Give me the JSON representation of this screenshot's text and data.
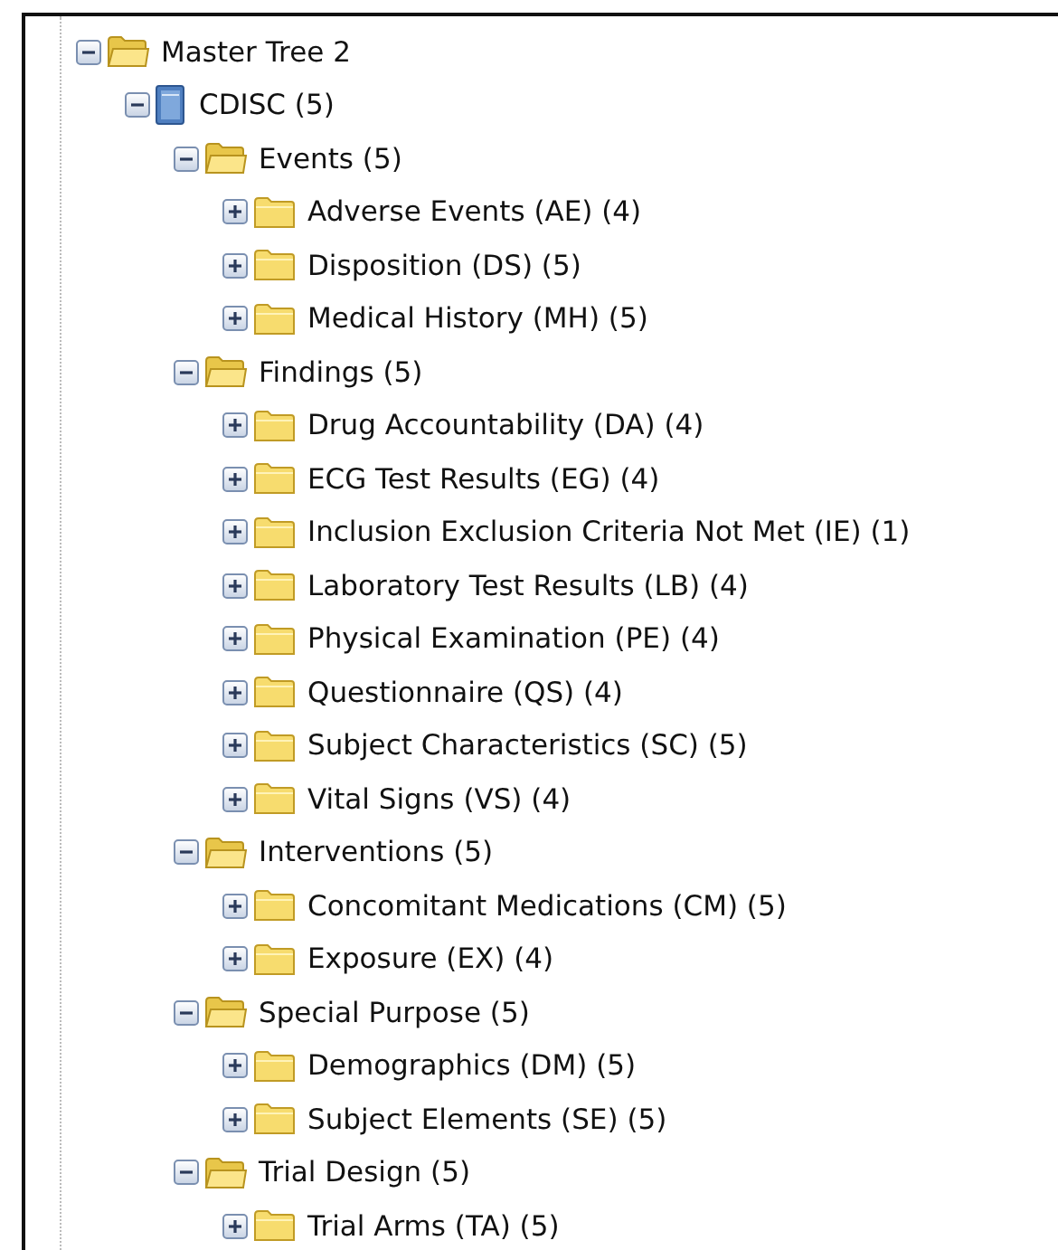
{
  "tree": [
    {
      "label": "Master Tree 2",
      "kind": "folder",
      "expanded": true,
      "children": [
        {
          "label": "CDISC (5)",
          "kind": "book",
          "expanded": true,
          "children": [
            {
              "label": "Events (5)",
              "kind": "folder",
              "expanded": true,
              "children": [
                {
                  "label": "Adverse Events (AE) (4)",
                  "kind": "folder",
                  "expanded": false
                },
                {
                  "label": "Disposition (DS) (5)",
                  "kind": "folder",
                  "expanded": false
                },
                {
                  "label": "Medical History (MH) (5)",
                  "kind": "folder",
                  "expanded": false
                }
              ]
            },
            {
              "label": "Findings (5)",
              "kind": "folder",
              "expanded": true,
              "children": [
                {
                  "label": "Drug Accountability (DA) (4)",
                  "kind": "folder",
                  "expanded": false
                },
                {
                  "label": "ECG Test Results (EG) (4)",
                  "kind": "folder",
                  "expanded": false
                },
                {
                  "label": "Inclusion Exclusion Criteria Not Met (IE) (1)",
                  "kind": "folder",
                  "expanded": false
                },
                {
                  "label": "Laboratory Test Results (LB) (4)",
                  "kind": "folder",
                  "expanded": false
                },
                {
                  "label": "Physical Examination (PE) (4)",
                  "kind": "folder",
                  "expanded": false
                },
                {
                  "label": "Questionnaire (QS) (4)",
                  "kind": "folder",
                  "expanded": false
                },
                {
                  "label": "Subject Characteristics (SC) (5)",
                  "kind": "folder",
                  "expanded": false
                },
                {
                  "label": "Vital Signs (VS) (4)",
                  "kind": "folder",
                  "expanded": false
                }
              ]
            },
            {
              "label": "Interventions (5)",
              "kind": "folder",
              "expanded": true,
              "children": [
                {
                  "label": "Concomitant Medications (CM) (5)",
                  "kind": "folder",
                  "expanded": false
                },
                {
                  "label": "Exposure (EX) (4)",
                  "kind": "folder",
                  "expanded": false
                }
              ]
            },
            {
              "label": "Special Purpose (5)",
              "kind": "folder",
              "expanded": true,
              "children": [
                {
                  "label": "Demographics (DM) (5)",
                  "kind": "folder",
                  "expanded": false
                },
                {
                  "label": "Subject Elements (SE) (5)",
                  "kind": "folder",
                  "expanded": false
                }
              ]
            },
            {
              "label": "Trial Design (5)",
              "kind": "folder",
              "expanded": true,
              "children": [
                {
                  "label": "Trial Arms (TA) (5)",
                  "kind": "folder",
                  "expanded": false
                }
              ]
            }
          ]
        }
      ]
    }
  ]
}
